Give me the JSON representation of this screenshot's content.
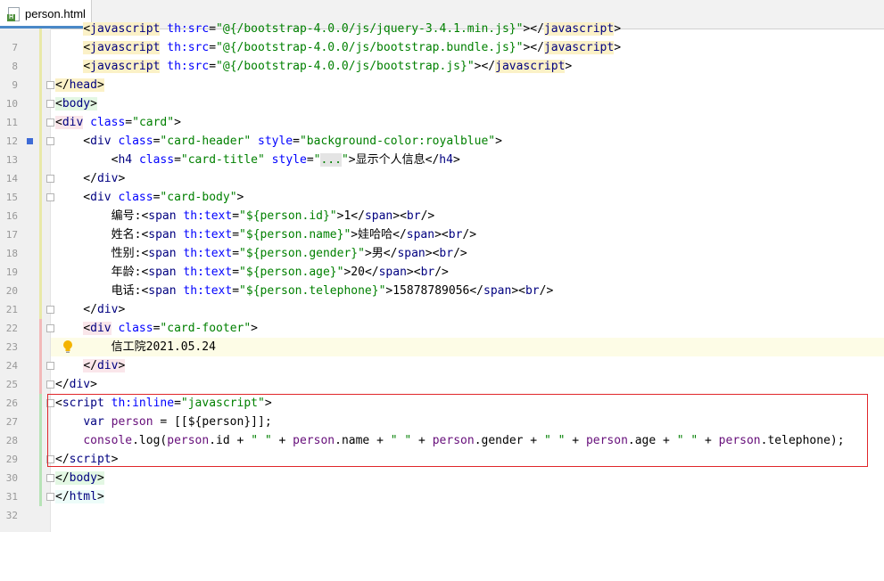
{
  "tab": {
    "filename": "person.html",
    "icon": "thymeleaf-html-file-icon"
  },
  "lines": [
    {
      "n": "7"
    },
    {
      "n": "8"
    },
    {
      "n": "9"
    },
    {
      "n": "10"
    },
    {
      "n": "11"
    },
    {
      "n": "12"
    },
    {
      "n": "13"
    },
    {
      "n": "14"
    },
    {
      "n": "15"
    },
    {
      "n": "16"
    },
    {
      "n": "17"
    },
    {
      "n": "18"
    },
    {
      "n": "19"
    },
    {
      "n": "20"
    },
    {
      "n": "21"
    },
    {
      "n": "22"
    },
    {
      "n": "23"
    },
    {
      "n": "24"
    },
    {
      "n": "25"
    },
    {
      "n": "26"
    },
    {
      "n": "27"
    },
    {
      "n": "28"
    },
    {
      "n": "29"
    },
    {
      "n": "30"
    },
    {
      "n": "31"
    },
    {
      "n": "32"
    }
  ],
  "code": {
    "l7": "    <javascript th:src=\"@{/bootstrap-4.0.0/js/jquery-3.4.1.min.js}\"></javascript>",
    "l8a": "javascript",
    "l8b": "@{/bootstrap-4.0.0/js/bootstrap.bundle.js}",
    "l9a": "javascript",
    "l9b": "@{/bootstrap-4.0.0/js/bootstrap.js}",
    "l10": "head",
    "l11": "body",
    "l12a": "div",
    "l12b": "card",
    "l13a": "div",
    "l13b": "card-header",
    "l13c": "background-color:royalblue",
    "l14a": "h4",
    "l14b": "card-title",
    "l14c": "...",
    "l14d": "显示个人信息",
    "l14e": "h4",
    "l15": "div",
    "l16a": "div",
    "l16b": "card-body",
    "l17a": "编号:",
    "l17b": "${person.id}",
    "l17c": "1",
    "l18a": "姓名:",
    "l18b": "${person.name}",
    "l18c": "娃哈哈",
    "l19a": "性别:",
    "l19b": "${person.gender}",
    "l19c": "男",
    "l20a": "年龄:",
    "l20b": "${person.age}",
    "l20c": "20",
    "l21a": "电话:",
    "l21b": "${person.telephone}",
    "l21c": "15878789056",
    "l22": "div",
    "l23a": "div",
    "l23b": "card-footer",
    "l24": "信工院2021.05.24",
    "l25": "div",
    "l26": "div",
    "l27a": "script",
    "l27b": "th:inline",
    "l27c": "javascript",
    "l28a": "var",
    "l28b": "person",
    "l28c": " = [[${person}]];",
    "l29a": "console",
    "l29b": ".log(",
    "l29c": "person",
    "l29d": ".id + ",
    "l29e": "\" \"",
    "l29f": "person",
    "l29g": ".name + ",
    "l29h": "\" \"",
    "l29i": "person",
    "l29j": ".gender + ",
    "l29k": "\" \"",
    "l29l": "person",
    "l29m": ".age + ",
    "l29n": "\" \"",
    "l29o": "person",
    "l29p": ".telephone);",
    "l30": "script",
    "l31": "body",
    "l32": "html"
  },
  "colors": {
    "tag": "#000080",
    "attribute": "#0000ff",
    "attr_value": "#008000",
    "highlight_box": "#e0262a",
    "bookmark": "#3e6bd6"
  }
}
